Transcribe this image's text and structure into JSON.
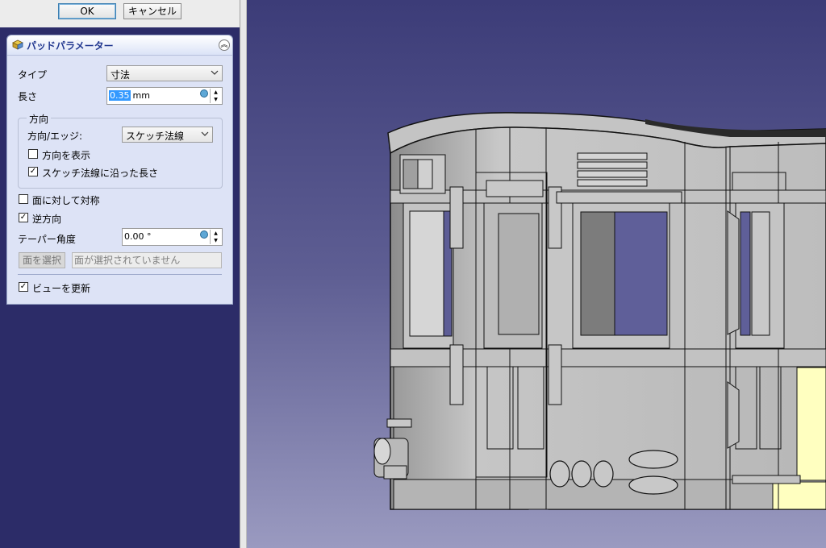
{
  "toolbar": {
    "ok_label": "OK",
    "cancel_label": "キャンセル"
  },
  "panel": {
    "title": "パッドパラメーター",
    "type_label": "タイプ",
    "type_value": "寸法",
    "length_label": "長さ",
    "length_value": "0.35",
    "length_unit": "mm",
    "direction_group": "方向",
    "direction_edge_label": "方向/エッジ:",
    "direction_edge_value": "スケッチ法線",
    "show_direction_label": "方向を表示",
    "show_direction_checked": false,
    "along_normal_label": "スケッチ法線に沿った長さ",
    "along_normal_checked": true,
    "symmetric_label": "面に対して対称",
    "symmetric_checked": false,
    "reversed_label": "逆方向",
    "reversed_checked": true,
    "taper_label": "テーパー角度",
    "taper_value": "0.00 °",
    "select_face_button": "面を選択",
    "face_field": "面が選択されていません",
    "update_view_label": "ビューを更新",
    "update_view_checked": true
  },
  "colors": {
    "viewport_top": "#3c3c78",
    "viewport_bottom": "#9a9ac0",
    "panel_bg": "#dde3f6",
    "model_gray": "#b9b9b9",
    "highlight_yellow": "#ffffc0"
  }
}
